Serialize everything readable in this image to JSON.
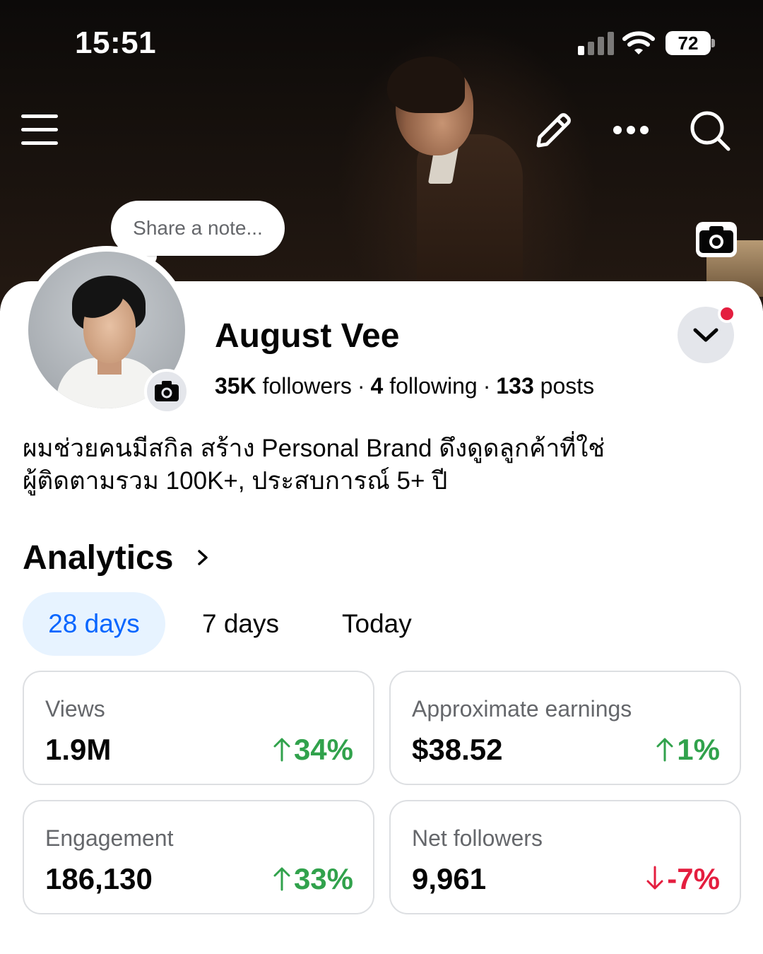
{
  "status_bar": {
    "time": "15:51",
    "battery": "72"
  },
  "note": {
    "placeholder": "Share a note..."
  },
  "profile": {
    "name": "August Vee",
    "followers_count": "35K",
    "followers_label": "followers",
    "following_count": "4",
    "following_label": "following",
    "posts_count": "133",
    "posts_label": "posts",
    "bio": [
      "ผมช่วยคนมีสกิล สร้าง Personal Brand ดึงดูดลูกค้าที่ใช่",
      "ผู้ติดตามรวม 100K+, ประสบการณ์ 5+ ปี"
    ]
  },
  "analytics": {
    "title": "Analytics",
    "tabs": [
      {
        "label": "28 days",
        "active": true
      },
      {
        "label": "7 days",
        "active": false
      },
      {
        "label": "Today",
        "active": false
      }
    ],
    "cards": [
      {
        "label": "Views",
        "value": "1.9M",
        "change": "34%",
        "direction": "up"
      },
      {
        "label": "Approximate earnings",
        "value": "$38.52",
        "change": "1%",
        "direction": "up"
      },
      {
        "label": "Engagement",
        "value": "186,130",
        "change": "33%",
        "direction": "up"
      },
      {
        "label": "Net followers",
        "value": "9,961",
        "change": "-7%",
        "direction": "down"
      }
    ]
  },
  "colors": {
    "accent": "#0866ff",
    "accent_bg": "#e7f3ff",
    "positive": "#31a24c",
    "negative": "#e41e3f",
    "notification_dot": "#e41e3f"
  },
  "icons": [
    "menu-icon",
    "edit-pencil-icon",
    "more-icon",
    "search-icon",
    "camera-icon",
    "chevron-down-icon",
    "chevron-right-icon",
    "arrow-up-icon",
    "arrow-down-icon"
  ]
}
